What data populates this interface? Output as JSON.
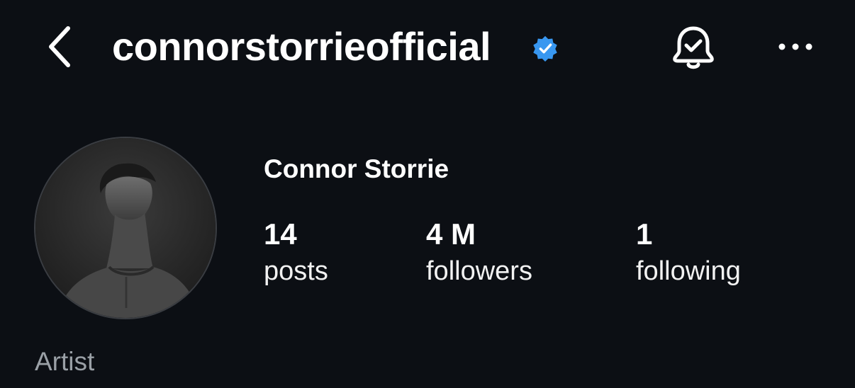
{
  "header": {
    "username": "connorstorrieofficial",
    "back_icon": "chevron-left-icon",
    "verified_icon": "verified-badge-icon",
    "verified_color": "#3897f0",
    "notifications_icon": "bell-check-icon",
    "more_icon": "more-horizontal-icon"
  },
  "profile": {
    "display_name": "Connor Storrie",
    "avatar_icon": "profile-photo",
    "category": "Artist",
    "stats": {
      "posts": {
        "count": "14",
        "label": "posts"
      },
      "followers": {
        "count": "4 M",
        "label": "followers"
      },
      "following": {
        "count": "1",
        "label": "following"
      }
    }
  },
  "colors": {
    "background": "#0c0f14",
    "text_primary": "#ffffff",
    "text_secondary": "#9aa0a6"
  }
}
